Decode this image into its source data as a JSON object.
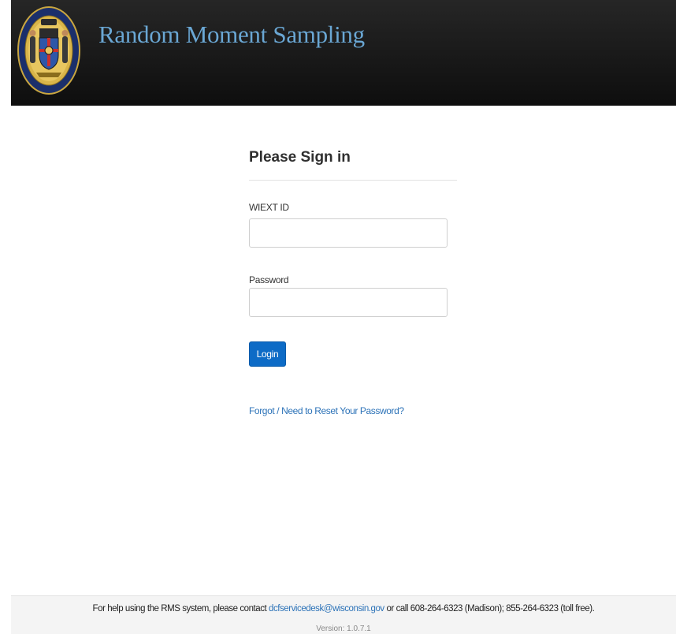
{
  "header": {
    "title": "Random Moment Sampling",
    "logo_icon": "wisconsin-state-seal",
    "logo_text": "GREAT SEAL OF THE STATE OF WISCONSIN"
  },
  "signin": {
    "heading": "Please Sign in",
    "id_label": "WIEXT ID",
    "id_value": "",
    "password_label": "Password",
    "password_value": "",
    "login_label": "Login",
    "forgot_link": "Forgot / Need to Reset Your Password?"
  },
  "footer": {
    "help_prefix": "For help using the RMS system, please contact ",
    "help_email": "dcfservicedesk@wisconsin.gov",
    "help_suffix": " or call 608-264-6323 (Madison); 855-264-6323 (toll free).",
    "version": "Version: 1.0.7.1"
  },
  "colors": {
    "header_bg": "#1a1a1a",
    "title": "#6aa7d4",
    "button": "#0d6bc6",
    "link": "#2d73b8"
  }
}
